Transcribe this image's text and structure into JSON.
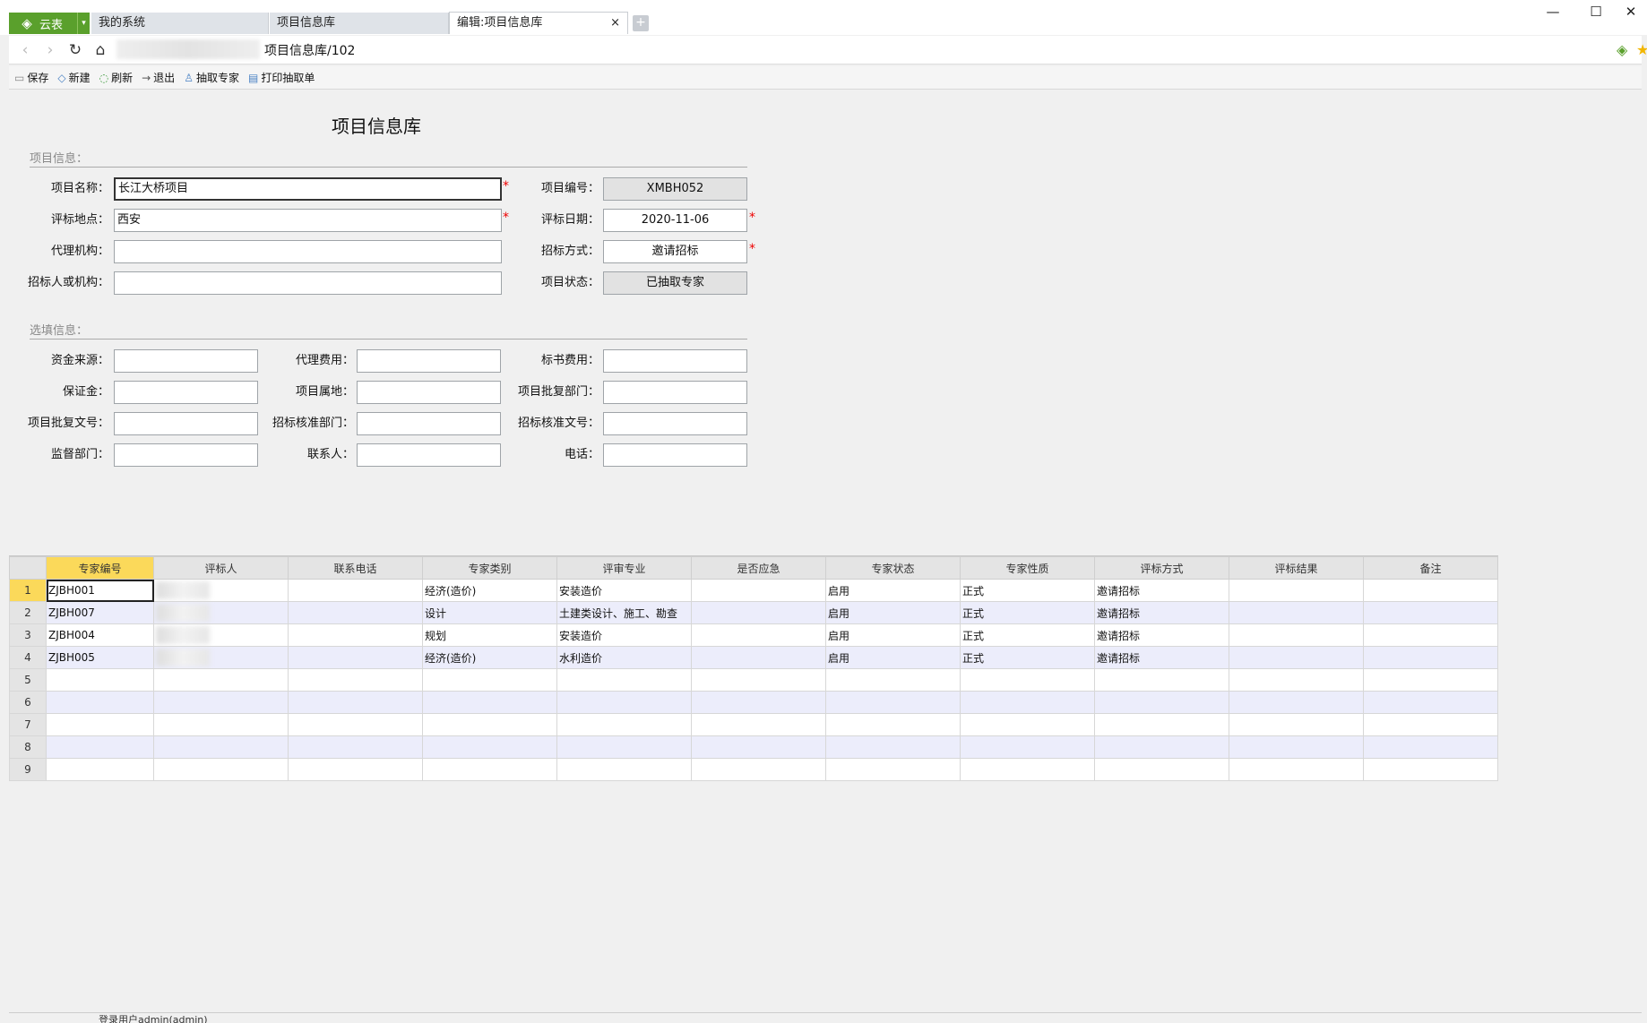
{
  "window": {
    "brand": "云表",
    "tabs": [
      {
        "label": "我的系统"
      },
      {
        "label": "项目信息库"
      },
      {
        "label": "编辑:项目信息库"
      }
    ],
    "close_tab": "×",
    "new_tab": "+",
    "minimize": "—",
    "maximize": "☐",
    "close": "✕"
  },
  "nav": {
    "address_suffix": "项目信息库/102"
  },
  "toolbar": {
    "save": "保存",
    "new": "新建",
    "refresh": "刷新",
    "exit": "退出",
    "draw_expert": "抽取专家",
    "print": "打印抽取单"
  },
  "form": {
    "title": "项目信息库",
    "section1": "项目信息：",
    "section2": "选填信息：",
    "project_name_label": "项目名称：",
    "project_name": "长江大桥项目",
    "project_no_label": "项目编号：",
    "project_no": "XMBH052",
    "eval_location_label": "评标地点：",
    "eval_location": "西安",
    "eval_date_label": "评标日期：",
    "eval_date": "2020-11-06",
    "agency_label": "代理机构：",
    "agency": "",
    "bid_method_label": "招标方式：",
    "bid_method": "邀请招标",
    "tenderer_label": "招标人或机构：",
    "tenderer": "",
    "project_status_label": "项目状态：",
    "project_status": "已抽取专家",
    "fund_source_label": "资金来源：",
    "agency_fee_label": "代理费用：",
    "doc_fee_label": "标书费用：",
    "deposit_label": "保证金：",
    "project_location_label": "项目属地：",
    "approval_dept_label": "项目批复部门：",
    "approval_doc_label": "项目批复文号：",
    "bid_approval_dept_label": "招标核准部门：",
    "bid_approval_doc_label": "招标核准文号：",
    "supervisor_label": "监督部门：",
    "contact_label": "联系人：",
    "phone_label": "电话：",
    "required_mark": "*"
  },
  "grid": {
    "headers": [
      "专家编号",
      "评标人",
      "联系电话",
      "专家类别",
      "评审专业",
      "是否应急",
      "专家状态",
      "专家性质",
      "评标方式",
      "评标结果",
      "备注"
    ],
    "rows": [
      {
        "n": "1",
        "c": [
          "ZJBH001",
          "",
          "",
          "经济(造价)",
          "安装造价",
          "",
          "启用",
          "正式",
          "邀请招标",
          "",
          ""
        ]
      },
      {
        "n": "2",
        "c": [
          "ZJBH007",
          "",
          "",
          "设计",
          "土建类设计、施工、勘查",
          "",
          "启用",
          "正式",
          "邀请招标",
          "",
          ""
        ]
      },
      {
        "n": "3",
        "c": [
          "ZJBH004",
          "",
          "",
          "规划",
          "安装造价",
          "",
          "启用",
          "正式",
          "邀请招标",
          "",
          ""
        ]
      },
      {
        "n": "4",
        "c": [
          "ZJBH005",
          "",
          "",
          "经济(造价)",
          "水利造价",
          "",
          "启用",
          "正式",
          "邀请招标",
          "",
          ""
        ]
      },
      {
        "n": "5",
        "c": [
          "",
          "",
          "",
          "",
          "",
          "",
          "",
          "",
          "",
          "",
          ""
        ]
      },
      {
        "n": "6",
        "c": [
          "",
          "",
          "",
          "",
          "",
          "",
          "",
          "",
          "",
          "",
          ""
        ]
      },
      {
        "n": "7",
        "c": [
          "",
          "",
          "",
          "",
          "",
          "",
          "",
          "",
          "",
          "",
          ""
        ]
      },
      {
        "n": "8",
        "c": [
          "",
          "",
          "",
          "",
          "",
          "",
          "",
          "",
          "",
          "",
          ""
        ]
      },
      {
        "n": "9",
        "c": [
          "",
          "",
          "",
          "",
          "",
          "",
          "",
          "",
          "",
          "",
          ""
        ]
      }
    ]
  },
  "status": {
    "user": "登录用户admin(admin)"
  },
  "colors": {
    "brand": "#5aa02c",
    "selection": "#fbd95a",
    "alt_row": "#ecedfb",
    "required": "#e00000"
  }
}
